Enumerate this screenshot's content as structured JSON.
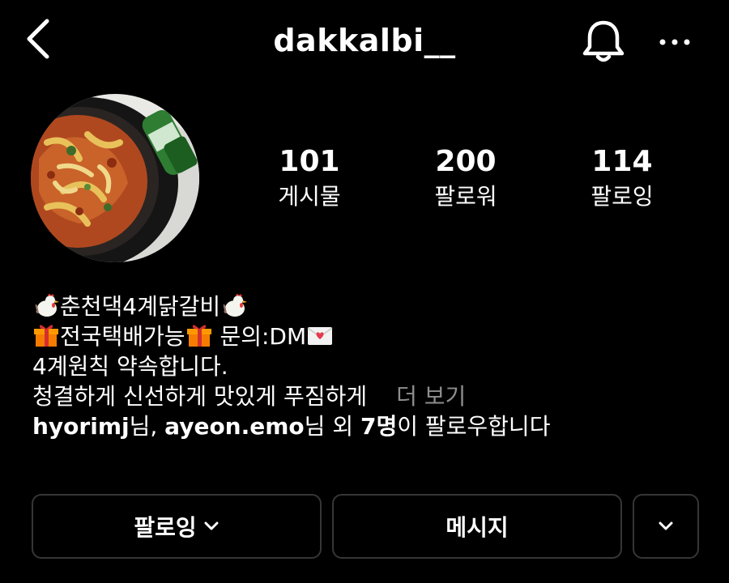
{
  "header": {
    "username": "dakkalbi__"
  },
  "stats": [
    {
      "value": "101",
      "label": "게시물"
    },
    {
      "value": "200",
      "label": "팔로워"
    },
    {
      "value": "114",
      "label": "팔로잉"
    }
  ],
  "bio": {
    "line1": "춘천댁4계닭갈비",
    "line2a": "전국택배가능",
    "line2b": " 문의:DM",
    "line3": "4계원칙 약속합니다.",
    "line4": "청결하게 신선하게 맛있게 푸짐하게",
    "more": "더 보기"
  },
  "followed_by": {
    "user1": "hyorimj",
    "suffix1": "님, ",
    "user2": "ayeon.emo",
    "suffix2": "님 외 ",
    "count": "7명",
    "suffix3": "이 팔로우합니다"
  },
  "buttons": {
    "following": "팔로잉",
    "message": "메시지"
  },
  "icons": {
    "back": "chevron-left-icon",
    "bell": "bell-icon",
    "more": "more-horizontal-icon",
    "rooster": "rooster-emoji",
    "gift": "gift-emoji",
    "love_letter": "love-letter-emoji"
  },
  "colors": {
    "background": "#000000",
    "text": "#ffffff",
    "muted": "#8e8e8e",
    "border": "#363636"
  }
}
